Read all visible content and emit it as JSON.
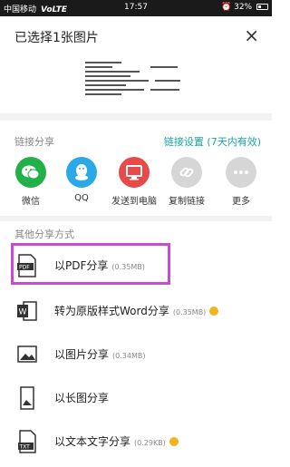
{
  "statusbar": {
    "carrier": "中国移动",
    "network": "VoLTE",
    "time": "17:57",
    "battery": "32%"
  },
  "header": {
    "title": "已选择1张图片",
    "close_icon": "close-icon"
  },
  "link_share": {
    "label": "链接分享",
    "settings": "链接设置 (7天内有效)",
    "items": [
      {
        "label": "微信",
        "icon": "wechat-icon",
        "color": "#22b04a"
      },
      {
        "label": "QQ",
        "icon": "qq-icon",
        "color": "#2aa9e6"
      },
      {
        "label": "发送到电脑",
        "icon": "computer-icon",
        "color": "#e84a4a"
      },
      {
        "label": "复制链接",
        "icon": "link-icon",
        "color": "#d6d6d6"
      },
      {
        "label": "更多",
        "icon": "more-icon",
        "color": "#d6d6d6"
      }
    ]
  },
  "other_share": {
    "label": "其他分享方式",
    "rows": [
      {
        "label": "以PDF分享",
        "size": "(0.35MB)",
        "icon": "pdf-icon"
      },
      {
        "label": "转为原版样式Word分享",
        "size": "(0.35MB)",
        "icon": "word-icon",
        "badge": true
      },
      {
        "label": "以图片分享",
        "size": "(0.34MB)",
        "icon": "image-icon"
      },
      {
        "label": "以长图分享",
        "size": "",
        "icon": "long-image-icon"
      },
      {
        "label": "以文本文字分享",
        "size": "(0.29KB)",
        "icon": "txt-icon",
        "badge": true
      }
    ]
  },
  "colors": {
    "highlight": "#c84bd3",
    "accent": "#1aa3a3"
  }
}
